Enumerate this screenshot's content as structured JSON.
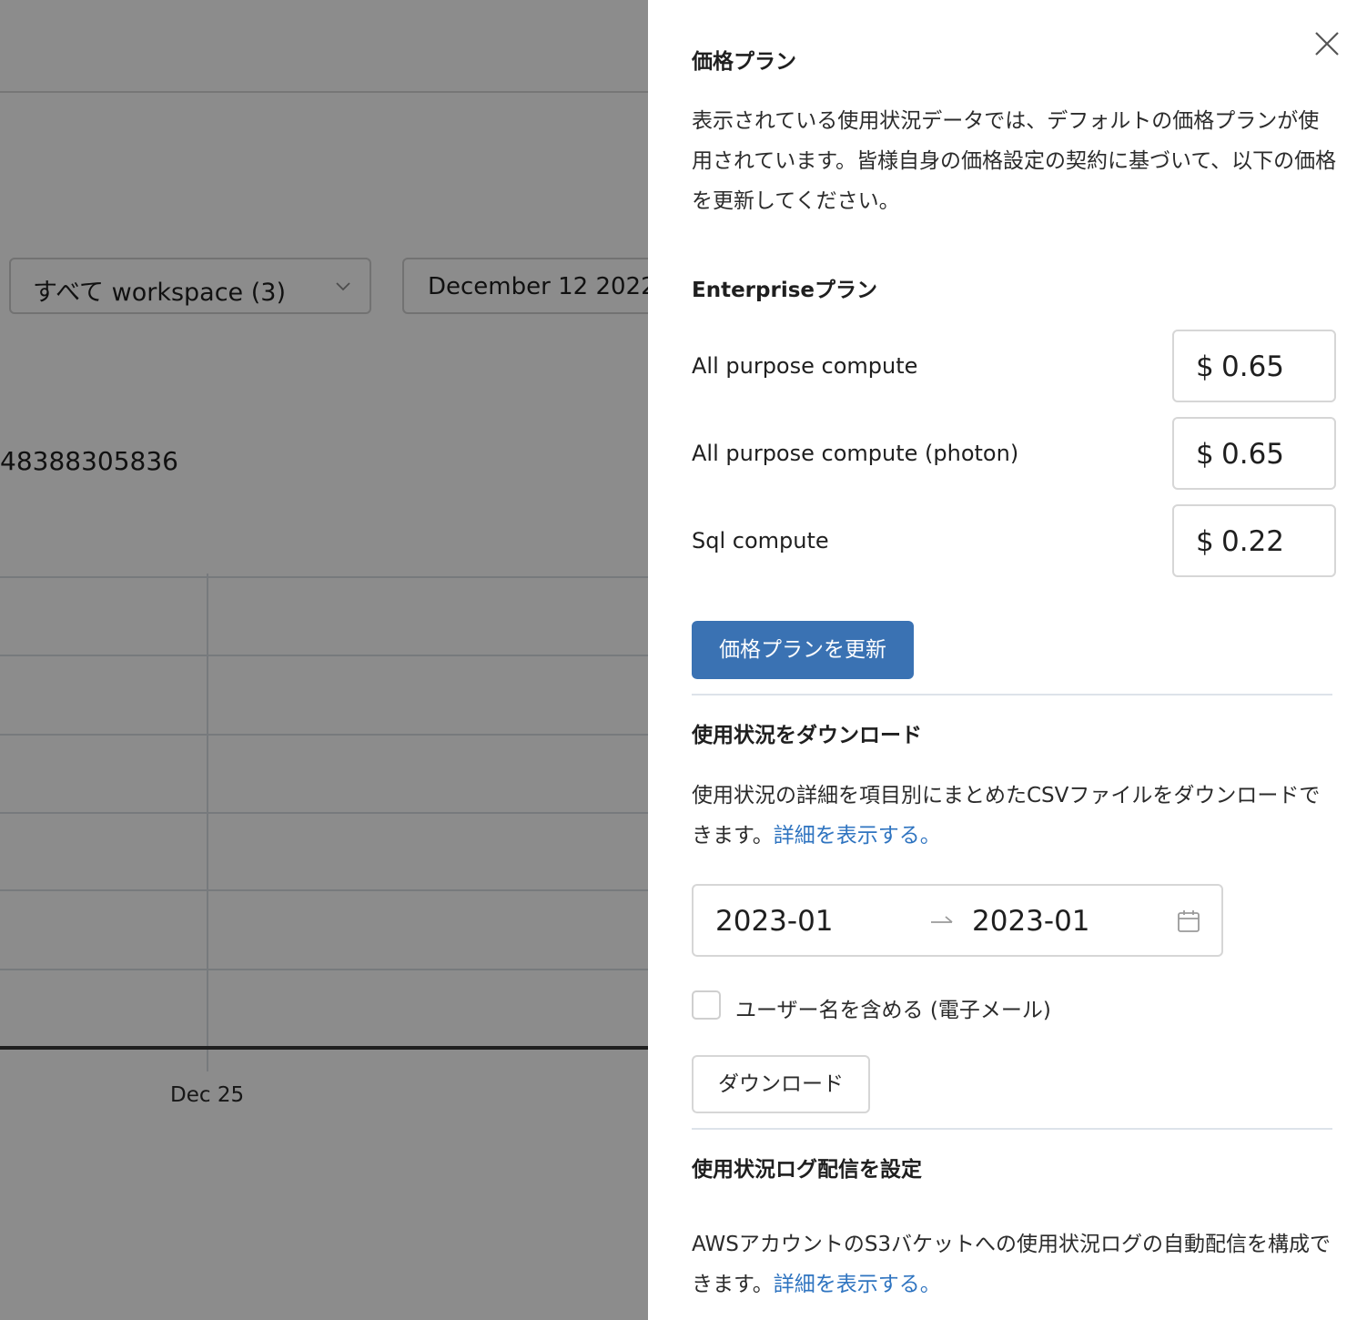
{
  "background": {
    "workspace_select": "すべて workspace (3)",
    "date_range": "December 12 2022-",
    "id_number": "48388305836",
    "chart_tick": "Dec 25"
  },
  "drawer": {
    "pricing": {
      "title": "価格プラン",
      "description": "表示されている使用状況データでは、デフォルトの価格プランが使用されています。皆様自身の価格設定の契約に基づいて、以下の価格を更新してください。",
      "plan_name": "Enterpriseプラン",
      "items": [
        {
          "label": "All purpose compute",
          "currency": "$",
          "value": "0.65"
        },
        {
          "label": "All purpose compute (photon)",
          "currency": "$",
          "value": "0.65"
        },
        {
          "label": "Sql compute",
          "currency": "$",
          "value": "0.22"
        }
      ],
      "update_button": "価格プランを更新"
    },
    "download": {
      "title": "使用状況をダウンロード",
      "description": "使用状況の詳細を項目別にまとめたCSVファイルをダウンロードできます。",
      "link": "詳細を表示する。",
      "from": "2023-01",
      "to": "2023-01",
      "checkbox_label": "ユーザー名を含める (電子メール)",
      "checkbox_checked": false,
      "button": "ダウンロード"
    },
    "log_delivery": {
      "title": "使用状況ログ配信を設定",
      "description": "AWSアカウントのS3バケットへの使用状況ログの自動配信を構成できます。",
      "link": "詳細を表示する。"
    }
  },
  "colors": {
    "primary": "#3a72b3",
    "link": "#2f74c0",
    "overlay": "rgba(0,0,0,0.45)"
  }
}
